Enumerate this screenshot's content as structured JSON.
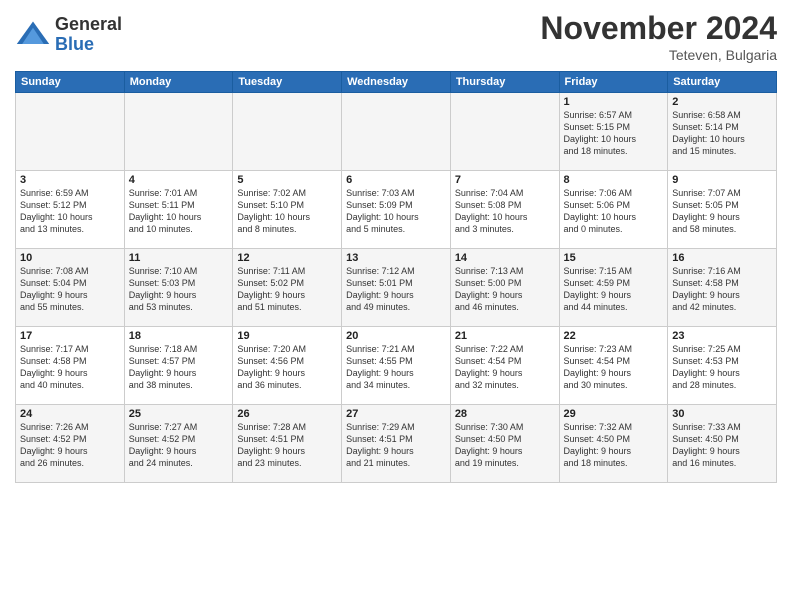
{
  "header": {
    "logo": {
      "general": "General",
      "blue": "Blue"
    },
    "title": "November 2024",
    "location": "Teteven, Bulgaria"
  },
  "weekdays": [
    "Sunday",
    "Monday",
    "Tuesday",
    "Wednesday",
    "Thursday",
    "Friday",
    "Saturday"
  ],
  "weeks": [
    [
      {
        "day": "",
        "info": ""
      },
      {
        "day": "",
        "info": ""
      },
      {
        "day": "",
        "info": ""
      },
      {
        "day": "",
        "info": ""
      },
      {
        "day": "",
        "info": ""
      },
      {
        "day": "1",
        "info": "Sunrise: 6:57 AM\nSunset: 5:15 PM\nDaylight: 10 hours\nand 18 minutes."
      },
      {
        "day": "2",
        "info": "Sunrise: 6:58 AM\nSunset: 5:14 PM\nDaylight: 10 hours\nand 15 minutes."
      }
    ],
    [
      {
        "day": "3",
        "info": "Sunrise: 6:59 AM\nSunset: 5:12 PM\nDaylight: 10 hours\nand 13 minutes."
      },
      {
        "day": "4",
        "info": "Sunrise: 7:01 AM\nSunset: 5:11 PM\nDaylight: 10 hours\nand 10 minutes."
      },
      {
        "day": "5",
        "info": "Sunrise: 7:02 AM\nSunset: 5:10 PM\nDaylight: 10 hours\nand 8 minutes."
      },
      {
        "day": "6",
        "info": "Sunrise: 7:03 AM\nSunset: 5:09 PM\nDaylight: 10 hours\nand 5 minutes."
      },
      {
        "day": "7",
        "info": "Sunrise: 7:04 AM\nSunset: 5:08 PM\nDaylight: 10 hours\nand 3 minutes."
      },
      {
        "day": "8",
        "info": "Sunrise: 7:06 AM\nSunset: 5:06 PM\nDaylight: 10 hours\nand 0 minutes."
      },
      {
        "day": "9",
        "info": "Sunrise: 7:07 AM\nSunset: 5:05 PM\nDaylight: 9 hours\nand 58 minutes."
      }
    ],
    [
      {
        "day": "10",
        "info": "Sunrise: 7:08 AM\nSunset: 5:04 PM\nDaylight: 9 hours\nand 55 minutes."
      },
      {
        "day": "11",
        "info": "Sunrise: 7:10 AM\nSunset: 5:03 PM\nDaylight: 9 hours\nand 53 minutes."
      },
      {
        "day": "12",
        "info": "Sunrise: 7:11 AM\nSunset: 5:02 PM\nDaylight: 9 hours\nand 51 minutes."
      },
      {
        "day": "13",
        "info": "Sunrise: 7:12 AM\nSunset: 5:01 PM\nDaylight: 9 hours\nand 49 minutes."
      },
      {
        "day": "14",
        "info": "Sunrise: 7:13 AM\nSunset: 5:00 PM\nDaylight: 9 hours\nand 46 minutes."
      },
      {
        "day": "15",
        "info": "Sunrise: 7:15 AM\nSunset: 4:59 PM\nDaylight: 9 hours\nand 44 minutes."
      },
      {
        "day": "16",
        "info": "Sunrise: 7:16 AM\nSunset: 4:58 PM\nDaylight: 9 hours\nand 42 minutes."
      }
    ],
    [
      {
        "day": "17",
        "info": "Sunrise: 7:17 AM\nSunset: 4:58 PM\nDaylight: 9 hours\nand 40 minutes."
      },
      {
        "day": "18",
        "info": "Sunrise: 7:18 AM\nSunset: 4:57 PM\nDaylight: 9 hours\nand 38 minutes."
      },
      {
        "day": "19",
        "info": "Sunrise: 7:20 AM\nSunset: 4:56 PM\nDaylight: 9 hours\nand 36 minutes."
      },
      {
        "day": "20",
        "info": "Sunrise: 7:21 AM\nSunset: 4:55 PM\nDaylight: 9 hours\nand 34 minutes."
      },
      {
        "day": "21",
        "info": "Sunrise: 7:22 AM\nSunset: 4:54 PM\nDaylight: 9 hours\nand 32 minutes."
      },
      {
        "day": "22",
        "info": "Sunrise: 7:23 AM\nSunset: 4:54 PM\nDaylight: 9 hours\nand 30 minutes."
      },
      {
        "day": "23",
        "info": "Sunrise: 7:25 AM\nSunset: 4:53 PM\nDaylight: 9 hours\nand 28 minutes."
      }
    ],
    [
      {
        "day": "24",
        "info": "Sunrise: 7:26 AM\nSunset: 4:52 PM\nDaylight: 9 hours\nand 26 minutes."
      },
      {
        "day": "25",
        "info": "Sunrise: 7:27 AM\nSunset: 4:52 PM\nDaylight: 9 hours\nand 24 minutes."
      },
      {
        "day": "26",
        "info": "Sunrise: 7:28 AM\nSunset: 4:51 PM\nDaylight: 9 hours\nand 23 minutes."
      },
      {
        "day": "27",
        "info": "Sunrise: 7:29 AM\nSunset: 4:51 PM\nDaylight: 9 hours\nand 21 minutes."
      },
      {
        "day": "28",
        "info": "Sunrise: 7:30 AM\nSunset: 4:50 PM\nDaylight: 9 hours\nand 19 minutes."
      },
      {
        "day": "29",
        "info": "Sunrise: 7:32 AM\nSunset: 4:50 PM\nDaylight: 9 hours\nand 18 minutes."
      },
      {
        "day": "30",
        "info": "Sunrise: 7:33 AM\nSunset: 4:50 PM\nDaylight: 9 hours\nand 16 minutes."
      }
    ]
  ]
}
